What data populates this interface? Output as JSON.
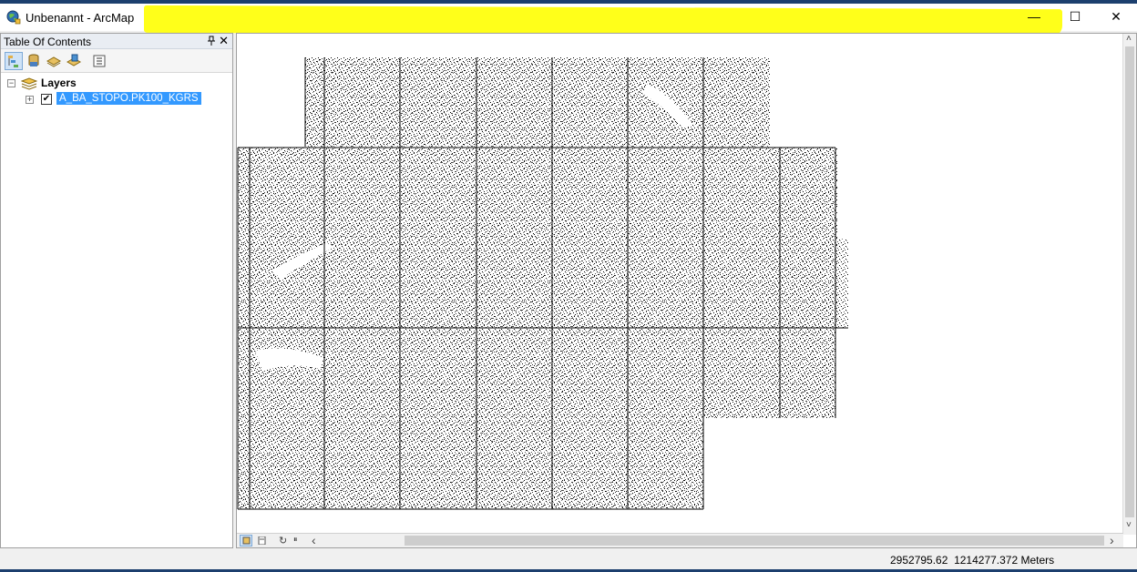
{
  "window": {
    "title": "Unbenannt - ArcMap",
    "minimize_glyph": "—",
    "maximize_glyph": "☐",
    "close_glyph": "✕"
  },
  "toc": {
    "title": "Table Of Contents",
    "pin_glyph": "📌",
    "close_glyph": "✕",
    "toolbar": [
      {
        "name": "list-by-drawing-order-icon",
        "active": true
      },
      {
        "name": "list-by-source-icon",
        "active": false
      },
      {
        "name": "list-by-visibility-icon",
        "active": false
      },
      {
        "name": "list-by-selection-icon",
        "active": false
      },
      {
        "name": "options-icon",
        "active": false
      }
    ],
    "tree": {
      "group_label": "Layers",
      "group_expanded": true,
      "layer_label": "A_BA_STOPO.PK100_KGRS",
      "layer_checked": true,
      "layer_collapsed": true
    }
  },
  "map": {
    "background": "#ffffff",
    "raster_color": "#000000"
  },
  "map_controls": {
    "view_buttons": [
      "data-view-icon",
      "layout-view-icon"
    ],
    "refresh_glyph": "↻",
    "pause_glyph": "⏸",
    "left_arrow": "‹",
    "right_arrow": "›",
    "up_arrow": "˄",
    "down_arrow": "˅"
  },
  "status": {
    "x": "2952795.62",
    "y": "1214277.372",
    "units": "Meters"
  },
  "colors": {
    "accent": "#3399ff",
    "highlight": "#ffff1a",
    "frame": "#1c3f6e"
  }
}
